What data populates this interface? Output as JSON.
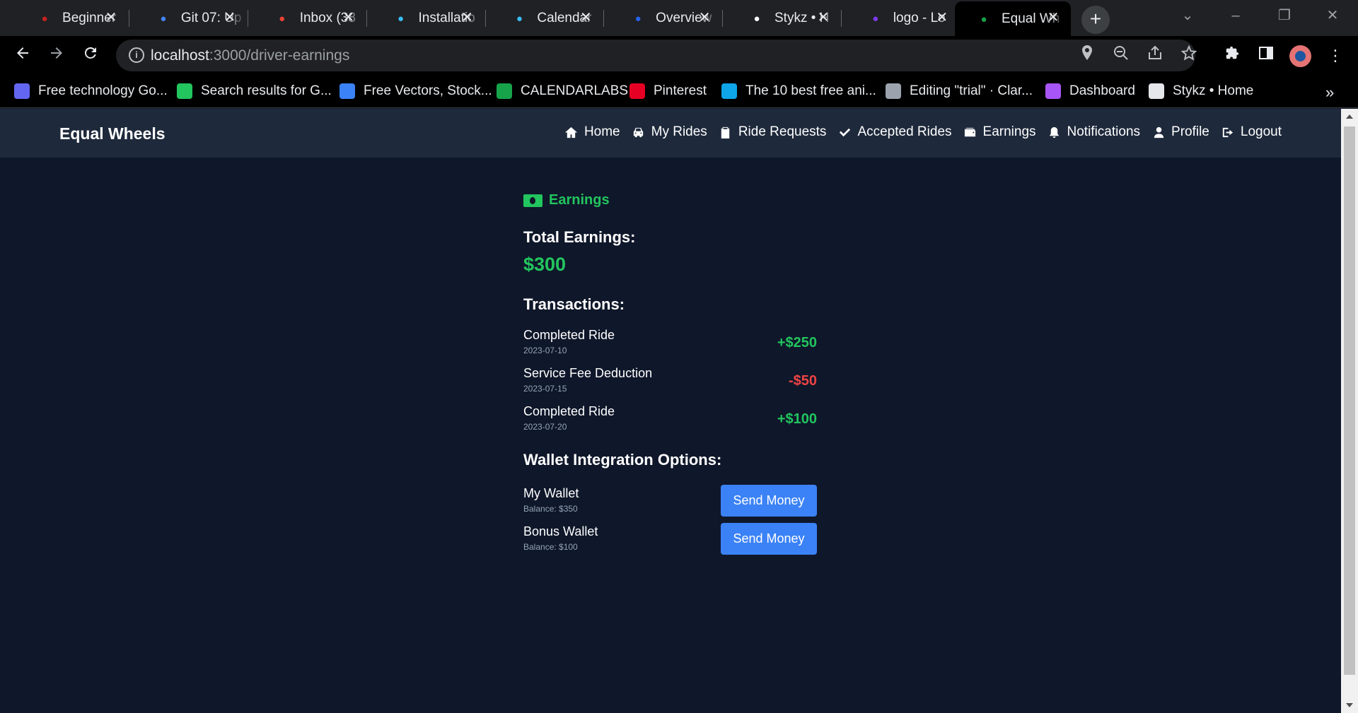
{
  "browser": {
    "tabs": [
      {
        "title": "Beginner",
        "icon": "gmail-icon",
        "color": "#c5221f"
      },
      {
        "title": "Git 07: Up",
        "icon": "git-icon",
        "color": "#4285f4"
      },
      {
        "title": "Inbox (38",
        "icon": "gmail-icon",
        "color": "#ea4335"
      },
      {
        "title": "Installatio",
        "icon": "tailwind-icon",
        "color": "#38bdf8"
      },
      {
        "title": "Calendar",
        "icon": "tailwind-icon",
        "color": "#38bdf8"
      },
      {
        "title": "Overview",
        "icon": "shield-icon",
        "color": "#2563eb"
      },
      {
        "title": "Stykz • H",
        "icon": "stykz-icon",
        "color": "#ffffff"
      },
      {
        "title": "logo - Lo",
        "icon": "canva-icon",
        "color": "#7c3aed"
      },
      {
        "title": "Equal Wh",
        "icon": "app-icon",
        "color": "#16a34a",
        "active": true
      }
    ],
    "url": {
      "host": "localhost",
      "path": ":3000/driver-earnings"
    },
    "bookmarks": [
      {
        "label": "Free technology Go...",
        "color": "#6366f1"
      },
      {
        "label": "Search results for G...",
        "color": "#22c55e"
      },
      {
        "label": "Free Vectors, Stock...",
        "color": "#3b82f6"
      },
      {
        "label": "CALENDARLABS",
        "color": "#16a34a"
      },
      {
        "label": "Pinterest",
        "color": "#e60023"
      },
      {
        "label": "The 10 best free ani...",
        "color": "#0ea5e9"
      },
      {
        "label": "Editing \"trial\" · Clar...",
        "color": "#9ca3af"
      },
      {
        "label": "Dashboard",
        "color": "#a855f7"
      },
      {
        "label": "Stykz • Home",
        "color": "#e5e7eb"
      }
    ]
  },
  "app": {
    "brand": "Equal Wheels",
    "nav": [
      {
        "label": "Home",
        "icon": "home-icon"
      },
      {
        "label": "My Rides",
        "icon": "car-icon"
      },
      {
        "label": "Ride Requests",
        "icon": "clipboard-icon"
      },
      {
        "label": "Accepted Rides",
        "icon": "check-icon"
      },
      {
        "label": "Earnings",
        "icon": "wallet-icon"
      },
      {
        "label": "Notifications",
        "icon": "bell-icon"
      },
      {
        "label": "Profile",
        "icon": "user-icon"
      },
      {
        "label": "Logout",
        "icon": "logout-icon"
      }
    ]
  },
  "earnings": {
    "heading": "Earnings",
    "total_label": "Total Earnings:",
    "total_value": "$300",
    "transactions_title": "Transactions:",
    "transactions": [
      {
        "label": "Completed Ride",
        "date": "2023-07-10",
        "amount": "+$250",
        "kind": "pos"
      },
      {
        "label": "Service Fee Deduction",
        "date": "2023-07-15",
        "amount": "-$50",
        "kind": "neg"
      },
      {
        "label": "Completed Ride",
        "date": "2023-07-20",
        "amount": "+$100",
        "kind": "pos"
      }
    ],
    "wallet_title": "Wallet Integration Options:",
    "wallets": [
      {
        "name": "My Wallet",
        "balance": "Balance: $350",
        "button": "Send Money"
      },
      {
        "name": "Bonus Wallet",
        "balance": "Balance: $100",
        "button": "Send Money"
      }
    ]
  },
  "colors": {
    "page_bg": "#0f172a",
    "navbar_bg": "#1e293b",
    "accent_green": "#22c55e",
    "danger_red": "#ef4444",
    "button_blue": "#3b82f6"
  }
}
